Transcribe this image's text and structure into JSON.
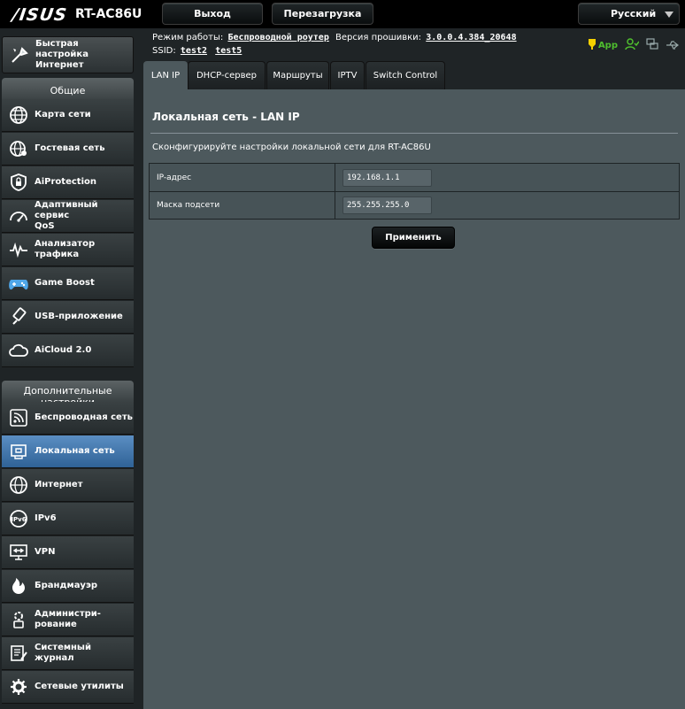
{
  "header": {
    "brand": "/ISUS",
    "model": "RT-AC86U",
    "logout_label": "Выход",
    "reboot_label": "Перезагрузка",
    "language": "Русский"
  },
  "info": {
    "mode_label": "Режим работы:",
    "mode_value": "Беспроводной роутер",
    "firmware_label": "Версия прошивки:",
    "firmware_value": "3.0.0.4.384_20648",
    "ssid_label": "SSID:",
    "ssid_values": [
      "test2",
      "test5"
    ],
    "app_label": "App"
  },
  "sidebar": {
    "quick_setup": "Быстрая настройка\nИнтернет",
    "general_header": "Общие",
    "general_items": [
      {
        "label": "Карта сети",
        "icon": "globe-icon"
      },
      {
        "label": "Гостевая сеть",
        "icon": "guest-globe-icon"
      },
      {
        "label": "AiProtection",
        "icon": "shield-lock-icon"
      },
      {
        "label": "Адаптивный сервис\nQoS",
        "icon": "gauge-icon"
      },
      {
        "label": "Анализатор\nтрафика",
        "icon": "traffic-wave-icon"
      },
      {
        "label": "Game Boost",
        "icon": "gamepad-icon"
      },
      {
        "label": "USB-приложение",
        "icon": "usb-icon"
      },
      {
        "label": "AiCloud 2.0",
        "icon": "cloud-icon"
      }
    ],
    "advanced_header": "Дополнительные настройки",
    "advanced_items": [
      {
        "label": "Беспроводная сеть",
        "icon": "wireless-icon"
      },
      {
        "label": "Локальная сеть",
        "icon": "lan-icon"
      },
      {
        "label": "Интернет",
        "icon": "internet-globe-icon"
      },
      {
        "label": "IPv6",
        "icon": "ipv6-icon"
      },
      {
        "label": "VPN",
        "icon": "vpn-icon"
      },
      {
        "label": "Брандмауэр",
        "icon": "firewall-icon"
      },
      {
        "label": "Администри-\nрование",
        "icon": "admin-icon"
      },
      {
        "label": "Системный журнал",
        "icon": "log-icon"
      },
      {
        "label": "Сетевые утилиты",
        "icon": "tools-icon"
      }
    ],
    "active_item": "Локальная сеть"
  },
  "tabs": [
    "LAN IP",
    "DHCP-сервер",
    "Маршруты",
    "IPTV",
    "Switch Control"
  ],
  "active_tab": "LAN IP",
  "main": {
    "title": "Локальная сеть - LAN IP",
    "description": "Сконфигурируйте настройки локальной сети для RT-AC86U",
    "fields": [
      {
        "label": "IP-адрес",
        "value": "192.168.1.1"
      },
      {
        "label": "Маска подсети",
        "value": "255.255.255.0"
      }
    ],
    "apply_label": "Применить"
  },
  "colors": {
    "panel": "#4d595d",
    "sidebar_active": "#3f72a8",
    "app_green": "#4fbf2e",
    "firmware_icon_yellow": "#f5d000"
  }
}
